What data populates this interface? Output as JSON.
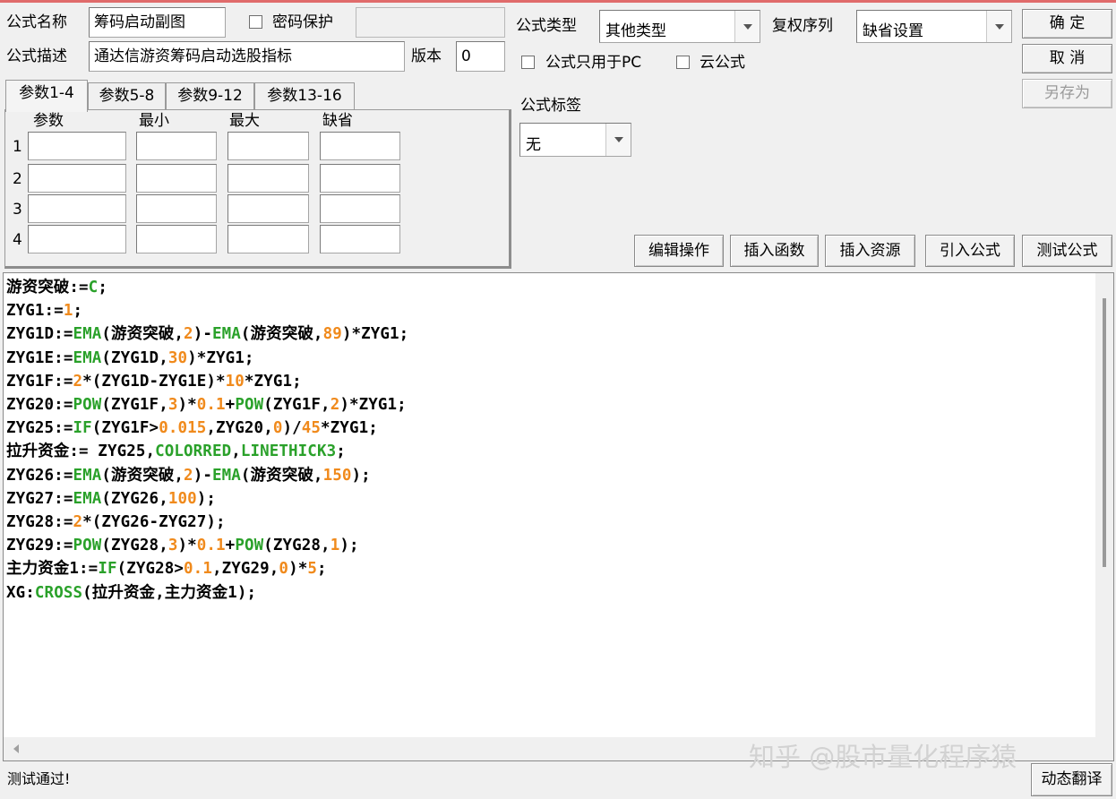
{
  "formula": {
    "name_label": "公式名称",
    "name_value": "筹码启动副图",
    "password_label": "密码保护",
    "password_checked": false,
    "password_value": "",
    "desc_label": "公式描述",
    "desc_value": "通达信游资筹码启动选股指标",
    "version_label": "版本",
    "version_value": "0",
    "type_label": "公式类型",
    "type_value": "其他类型",
    "restore_label": "复权序列",
    "restore_value": "缺省设置",
    "pc_only_label": "公式只用于PC",
    "pc_only_checked": false,
    "cloud_label": "云公式",
    "cloud_checked": false,
    "tag_label": "公式标签",
    "tag_value": "无"
  },
  "buttons": {
    "ok": "确 定",
    "cancel": "取 消",
    "save_as": "另存为",
    "edit": "编辑操作",
    "insert_func": "插入函数",
    "insert_res": "插入资源",
    "import": "引入公式",
    "test": "测试公式",
    "dynamic": "动态翻译"
  },
  "tabs": [
    "参数1-4",
    "参数5-8",
    "参数9-12",
    "参数13-16"
  ],
  "params": {
    "headers": [
      "参数",
      "最小",
      "最大",
      "缺省"
    ],
    "rows": [
      {
        "index": "1",
        "name": "",
        "min": "",
        "max": "",
        "default": ""
      },
      {
        "index": "2",
        "name": "",
        "min": "",
        "max": "",
        "default": ""
      },
      {
        "index": "3",
        "name": "",
        "min": "",
        "max": "",
        "default": ""
      },
      {
        "index": "4",
        "name": "",
        "min": "",
        "max": "",
        "default": ""
      }
    ]
  },
  "code_lines": [
    [
      [
        "t",
        "游资突破:="
      ],
      [
        "g",
        "C"
      ],
      [
        "t",
        ";"
      ]
    ],
    [
      [
        "t",
        "ZYG1:="
      ],
      [
        "o",
        "1"
      ],
      [
        "t",
        ";"
      ]
    ],
    [
      [
        "t",
        "ZYG1D:="
      ],
      [
        "g",
        "EMA"
      ],
      [
        "t",
        "(游资突破,"
      ],
      [
        "o",
        "2"
      ],
      [
        "t",
        ")-"
      ],
      [
        "g",
        "EMA"
      ],
      [
        "t",
        "(游资突破,"
      ],
      [
        "o",
        "89"
      ],
      [
        "t",
        ")*ZYG1;"
      ]
    ],
    [
      [
        "t",
        "ZYG1E:="
      ],
      [
        "g",
        "EMA"
      ],
      [
        "t",
        "(ZYG1D,"
      ],
      [
        "o",
        "30"
      ],
      [
        "t",
        ")*ZYG1;"
      ]
    ],
    [
      [
        "t",
        "ZYG1F:="
      ],
      [
        "o",
        "2"
      ],
      [
        "t",
        "*(ZYG1D-ZYG1E)*"
      ],
      [
        "o",
        "10"
      ],
      [
        "t",
        "*ZYG1;"
      ]
    ],
    [
      [
        "t",
        "ZYG20:="
      ],
      [
        "g",
        "POW"
      ],
      [
        "t",
        "(ZYG1F,"
      ],
      [
        "o",
        "3"
      ],
      [
        "t",
        ")*"
      ],
      [
        "o",
        "0.1"
      ],
      [
        "t",
        "+"
      ],
      [
        "g",
        "POW"
      ],
      [
        "t",
        "(ZYG1F,"
      ],
      [
        "o",
        "2"
      ],
      [
        "t",
        ")*ZYG1;"
      ]
    ],
    [
      [
        "t",
        "ZYG25:="
      ],
      [
        "g",
        "IF"
      ],
      [
        "t",
        "(ZYG1F>"
      ],
      [
        "o",
        "0.015"
      ],
      [
        "t",
        ",ZYG20,"
      ],
      [
        "o",
        "0"
      ],
      [
        "t",
        ")/"
      ],
      [
        "o",
        "45"
      ],
      [
        "t",
        "*ZYG1;"
      ]
    ],
    [
      [
        "t",
        "拉升资金:= ZYG25,"
      ],
      [
        "g",
        "COLORRED"
      ],
      [
        "t",
        ","
      ],
      [
        "g",
        "LINETHICK3"
      ],
      [
        "t",
        ";"
      ]
    ],
    [
      [
        "t",
        "ZYG26:="
      ],
      [
        "g",
        "EMA"
      ],
      [
        "t",
        "(游资突破,"
      ],
      [
        "o",
        "2"
      ],
      [
        "t",
        ")-"
      ],
      [
        "g",
        "EMA"
      ],
      [
        "t",
        "(游资突破,"
      ],
      [
        "o",
        "150"
      ],
      [
        "t",
        ");"
      ]
    ],
    [
      [
        "t",
        "ZYG27:="
      ],
      [
        "g",
        "EMA"
      ],
      [
        "t",
        "(ZYG26,"
      ],
      [
        "o",
        "100"
      ],
      [
        "t",
        ");"
      ]
    ],
    [
      [
        "t",
        "ZYG28:="
      ],
      [
        "o",
        "2"
      ],
      [
        "t",
        "*(ZYG26-ZYG27);"
      ]
    ],
    [
      [
        "t",
        "ZYG29:="
      ],
      [
        "g",
        "POW"
      ],
      [
        "t",
        "(ZYG28,"
      ],
      [
        "o",
        "3"
      ],
      [
        "t",
        ")*"
      ],
      [
        "o",
        "0.1"
      ],
      [
        "t",
        "+"
      ],
      [
        "g",
        "POW"
      ],
      [
        "t",
        "(ZYG28,"
      ],
      [
        "o",
        "1"
      ],
      [
        "t",
        ");"
      ]
    ],
    [
      [
        "t",
        "主力资金1:="
      ],
      [
        "g",
        "IF"
      ],
      [
        "t",
        "(ZYG28>"
      ],
      [
        "o",
        "0.1"
      ],
      [
        "t",
        ",ZYG29,"
      ],
      [
        "o",
        "0"
      ],
      [
        "t",
        ")*"
      ],
      [
        "o",
        "5"
      ],
      [
        "t",
        ";"
      ]
    ],
    [
      [
        "t",
        "XG:"
      ],
      [
        "g",
        "CROSS"
      ],
      [
        "t",
        "(拉升资金,主力资金1);"
      ]
    ]
  ],
  "status": "测试通过!",
  "watermark": "知乎 @股市量化程序猿",
  "colors": {
    "keyword": "#2aa12a",
    "number": "#f08a1c",
    "accent_line": "#e06b6b"
  }
}
